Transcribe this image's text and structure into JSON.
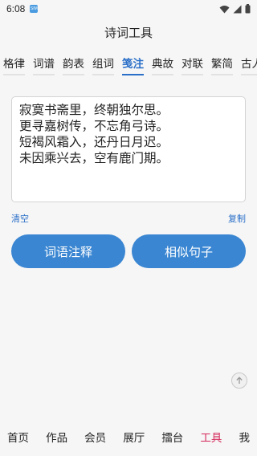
{
  "status": {
    "time": "6:08",
    "sim_badge": "SIM"
  },
  "app": {
    "title": "诗词工具"
  },
  "tabs": [
    {
      "label": "格律",
      "active": false
    },
    {
      "label": "词谱",
      "active": false
    },
    {
      "label": "韵表",
      "active": false
    },
    {
      "label": "组词",
      "active": false
    },
    {
      "label": "笺注",
      "active": true
    },
    {
      "label": "典故",
      "active": false
    },
    {
      "label": "对联",
      "active": false
    },
    {
      "label": "繁简",
      "active": false
    },
    {
      "label": "古人",
      "active": false
    }
  ],
  "poem": {
    "lines": [
      "寂寞书斋里，终朝独尔思。",
      "更寻嘉树传，不忘角弓诗。",
      "短褐风霜入，还丹日月迟。",
      "未因乘兴去，空有鹿门期。"
    ]
  },
  "actions": {
    "clear_label": "清空",
    "copy_label": "复制",
    "explain_label": "词语注释",
    "similar_label": "相似句子"
  },
  "bottom_nav": [
    {
      "label": "首页",
      "active": false
    },
    {
      "label": "作品",
      "active": false
    },
    {
      "label": "会员",
      "active": false
    },
    {
      "label": "展厅",
      "active": false
    },
    {
      "label": "擂台",
      "active": false
    },
    {
      "label": "工具",
      "active": true
    },
    {
      "label": "我",
      "active": false
    }
  ],
  "colors": {
    "accent": "#2a6fc8",
    "button": "#3a86d2",
    "nav_active": "#d4285a"
  }
}
